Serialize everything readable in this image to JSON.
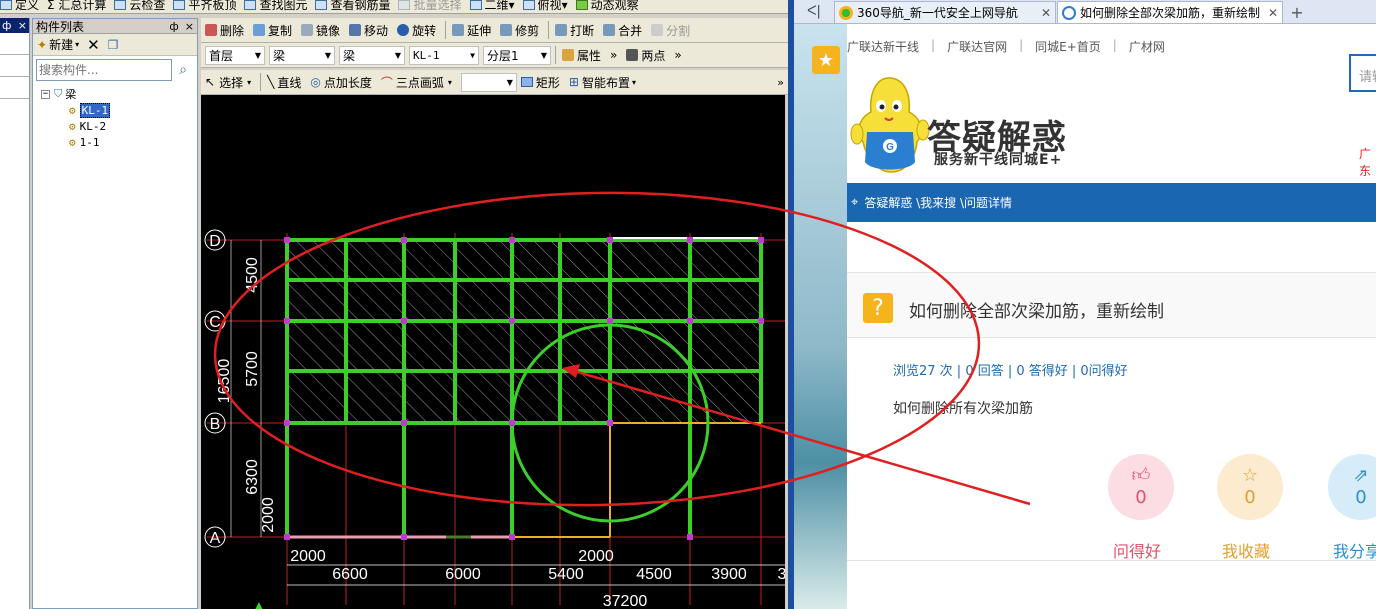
{
  "cad": {
    "menubar": [
      "定义",
      "Σ 汇总计算",
      "云检查",
      "平齐板顶",
      "查找图元",
      "查看钢筋量",
      "批量选择",
      "二维",
      "俯视",
      "动态观察"
    ],
    "left_strip": {
      "pin": "ф",
      "close": "×"
    },
    "component_panel": {
      "title": "构件列表",
      "pin": "ф",
      "close": "×",
      "new_label": "新建",
      "search_placeholder": "搜索构件...",
      "tree": {
        "root": "梁",
        "items": [
          "KL-1",
          "KL-2",
          "1-1"
        ]
      }
    },
    "toolbar1": {
      "delete": "删除",
      "copy": "复制",
      "mirror": "镜像",
      "move": "移动",
      "rotate": "旋转",
      "extend": "延伸",
      "trim": "修剪",
      "break": "打断",
      "merge": "合并",
      "split": "分割"
    },
    "toolbar2": {
      "floor": "首层",
      "type1": "梁",
      "type2": "梁",
      "element": "KL-1",
      "layer": "分层1",
      "properties": "属性",
      "two_points": "两点"
    },
    "toolbar3": {
      "select": "选择",
      "line": "直线",
      "point_length": "点加长度",
      "three_point_arc": "三点画弧",
      "rect": "矩形",
      "smart_layout": "智能布置"
    },
    "drawing": {
      "axis_rows": [
        "D",
        "C",
        "B",
        "A"
      ],
      "left_dims": [
        "4500",
        "5700",
        "16500",
        "6300",
        "2000"
      ],
      "bottom_dims_row1": [
        "2000",
        "2000"
      ],
      "bottom_dims_row2": [
        "6600",
        "6000",
        "5400",
        "4500",
        "3900",
        "3"
      ],
      "bottom_total": "37200"
    }
  },
  "browser": {
    "tabs": [
      {
        "title": "360导航_新一代安全上网导航",
        "active": false
      },
      {
        "title": "如何删除全部次梁加筋，重新绘制",
        "active": true
      }
    ],
    "toplinks": [
      "广联达新干线",
      "广联达官网",
      "同城E+首页",
      "广材网"
    ],
    "logo_title": "答疑解惑",
    "logo_sub": "服务新干线同城E+",
    "search_placeholder": "请输",
    "search_red": "广东",
    "breadcrumb": "答疑解惑 \\我来搜 \\问题详情",
    "question": {
      "title": "如何删除全部次梁加筋，重新绘制",
      "stats": "浏览27 次 | 0 回答 | 0 答得好 | 0问得好",
      "body": "如何删除所有次梁加筋"
    },
    "actions": [
      {
        "label": "问得好",
        "count": "0",
        "color": "#e0506a",
        "bg": "#fbdde3",
        "icon": "thumbs-up"
      },
      {
        "label": "我收藏",
        "count": "0",
        "color": "#e0a030",
        "bg": "#fcebcf",
        "icon": "star"
      },
      {
        "label": "我分享",
        "count": "0",
        "color": "#2a8fd0",
        "bg": "#d6ecf8",
        "icon": "share"
      }
    ]
  }
}
